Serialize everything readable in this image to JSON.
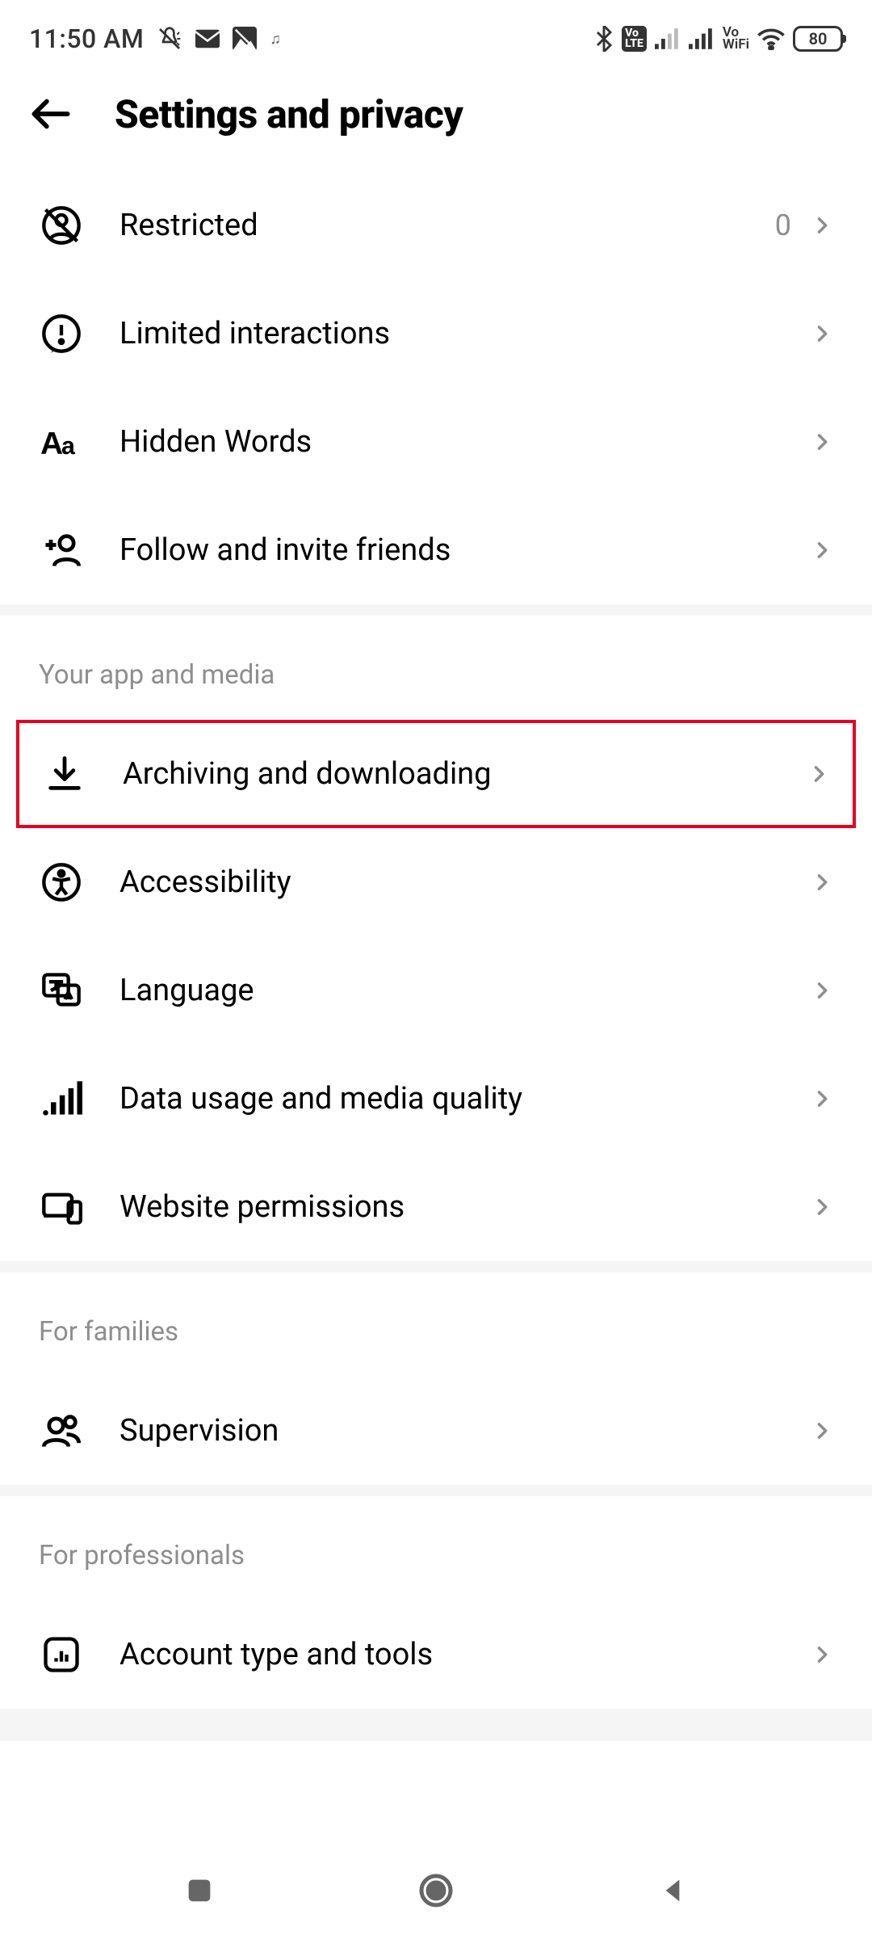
{
  "status": {
    "time": "11:50 AM",
    "battery": "80"
  },
  "header": {
    "title": "Settings and privacy"
  },
  "section1": {
    "items": [
      {
        "label": "Restricted",
        "value": "0"
      },
      {
        "label": "Limited interactions"
      },
      {
        "label": "Hidden Words"
      },
      {
        "label": "Follow and invite friends"
      }
    ]
  },
  "section2": {
    "title": "Your app and media",
    "items": [
      {
        "label": "Archiving and downloading"
      },
      {
        "label": "Accessibility"
      },
      {
        "label": "Language"
      },
      {
        "label": "Data usage and media quality"
      },
      {
        "label": "Website permissions"
      }
    ]
  },
  "section3": {
    "title": "For families",
    "items": [
      {
        "label": "Supervision"
      }
    ]
  },
  "section4": {
    "title": "For professionals",
    "items": [
      {
        "label": "Account type and tools"
      }
    ]
  }
}
